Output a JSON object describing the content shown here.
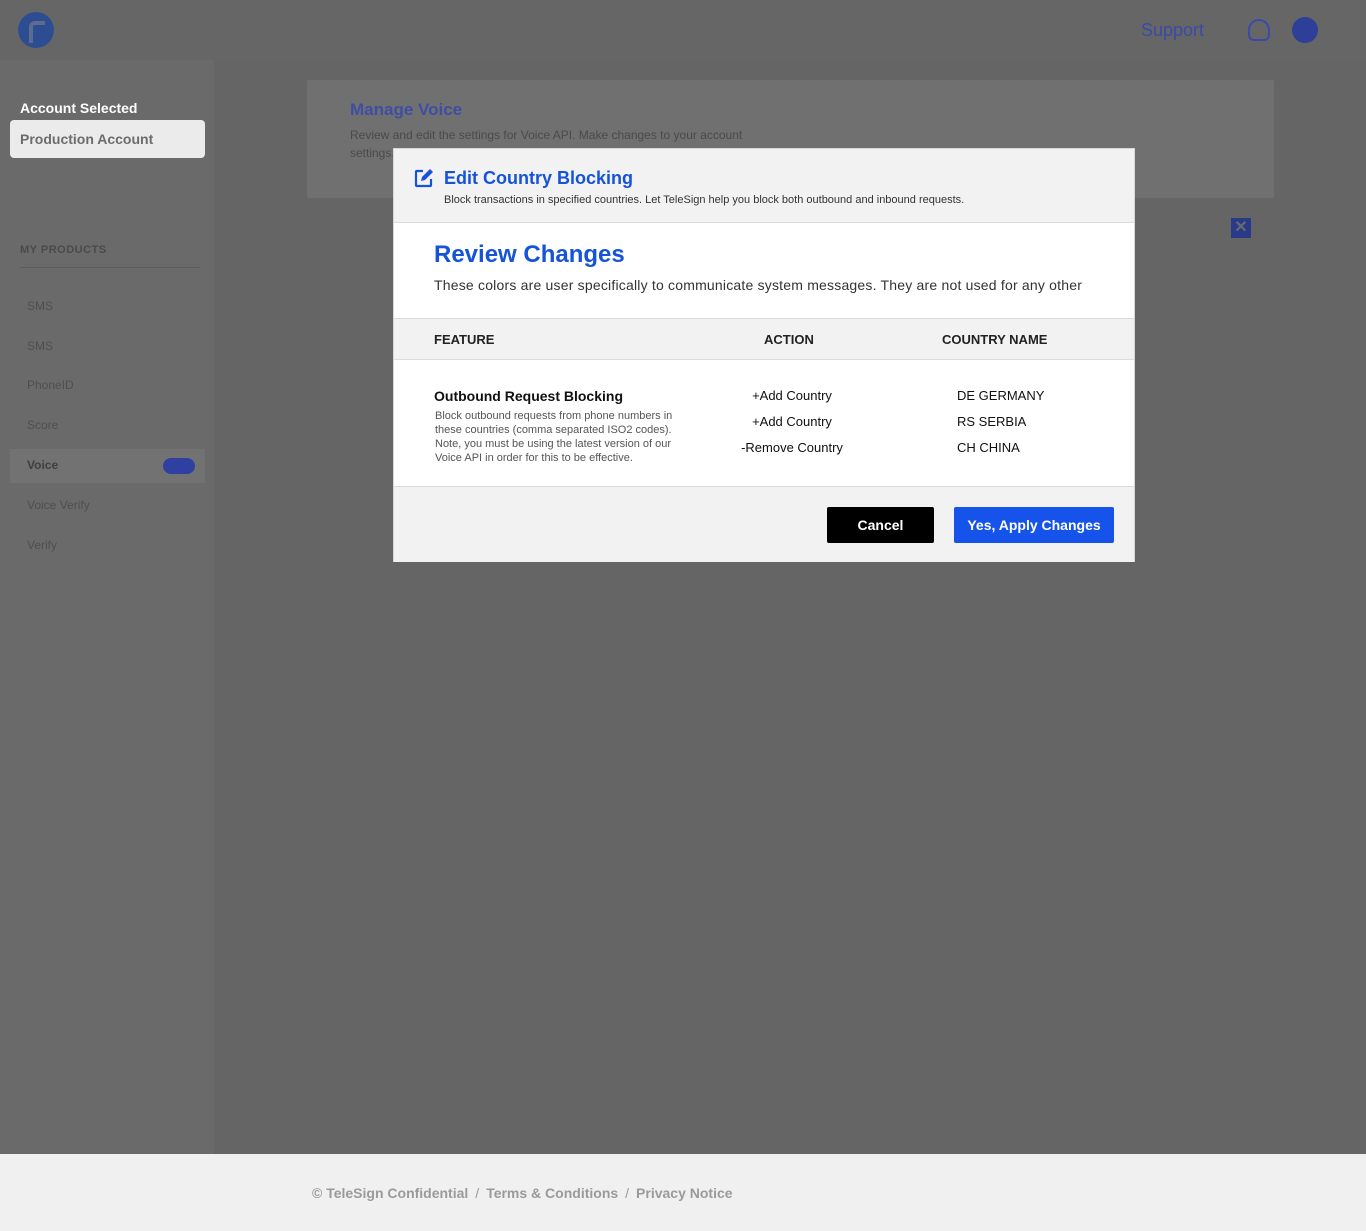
{
  "header": {
    "support_label": "Support",
    "logo_icon": "telesign-logo",
    "bell_icon": "bell-icon",
    "user_icon": "user-avatar-icon"
  },
  "sidebar": {
    "account_label": "Account Selected",
    "account_value": "Production Account",
    "products_label": "MY PRODUCTS",
    "items": [
      {
        "label": "SMS"
      },
      {
        "label": "SMS"
      },
      {
        "label": "PhoneID"
      },
      {
        "label": "Score"
      },
      {
        "label": "Voice",
        "active": true
      },
      {
        "label": "Voice Verify"
      },
      {
        "label": "Verify"
      }
    ]
  },
  "main": {
    "card_title": "Manage Voice",
    "card_desc": "Review and edit the settings for Voice API. Make changes to your account settings."
  },
  "modal": {
    "title": "Edit Country Blocking",
    "subtitle": "Block transactions in specified countries. Let TeleSign help you block both outbound and inbound requests.",
    "review_title": "Review Changes",
    "review_desc": "These colors are user specifically to communicate system messages.  They are not used for any other",
    "columns": [
      "FEATURE",
      "ACTION",
      "COUNTRY NAME"
    ],
    "feature": {
      "name": "Outbound Request Blocking",
      "description": "Block outbound requests from phone numbers in these countries (comma separated ISO2 codes). Note, you must be using the latest version of our Voice API in order for this to be effective."
    },
    "changes": [
      {
        "action": "+Add Country",
        "country": "DE GERMANY"
      },
      {
        "action": "+Add Country",
        "country": "RS SERBIA"
      },
      {
        "action": "-Remove Country",
        "country": "CH CHINA"
      }
    ],
    "cancel_label": "Cancel",
    "apply_label": "Yes, Apply Changes"
  },
  "footer": {
    "copyright": "© TeleSign Confidential",
    "terms": "Terms & Conditions",
    "privacy": "Privacy Notice"
  },
  "colors": {
    "accent": "#1553d8",
    "apply_button": "#1553ea",
    "cancel_button": "#000000",
    "overlay": "#656565"
  }
}
